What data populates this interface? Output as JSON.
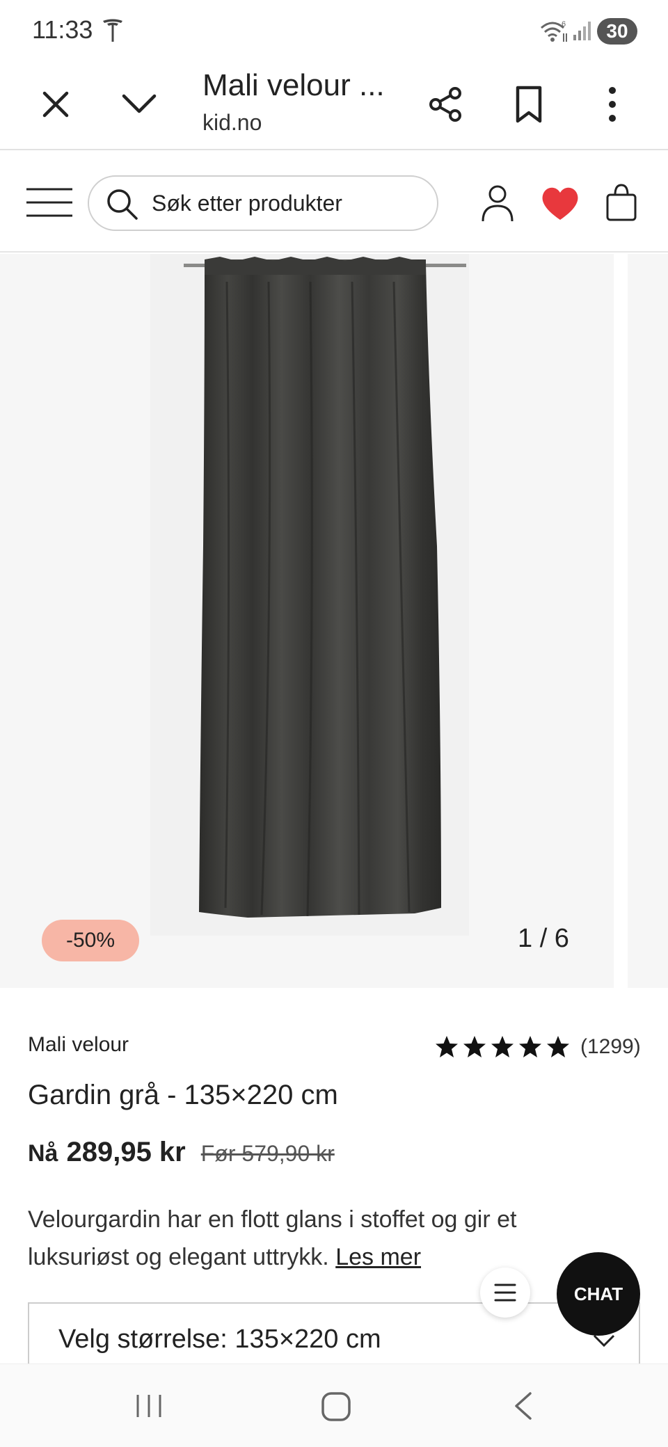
{
  "status_bar": {
    "time": "11:33",
    "battery": "30"
  },
  "browser": {
    "title": "Mali velour ...",
    "domain": "kid.no"
  },
  "header": {
    "search_placeholder": "Søk etter produkter"
  },
  "gallery": {
    "discount_badge": "-50%",
    "slide_counter": "1 / 6"
  },
  "product": {
    "brand": "Mali velour",
    "rating_stars": 5,
    "rating_count": "(1299)",
    "title": "Gardin grå - 135×220 cm",
    "price_now_label": "Nå",
    "price_now": "289,95 kr",
    "price_before": "Før 579,90 kr",
    "description": "Velourgardin har en flott glans i stoffet og gir et luksuriøst og elegant uttrykk.",
    "read_more": "Les mer"
  },
  "size_selector": {
    "label": "Velg størrelse: 135×220 cm"
  },
  "floating": {
    "chat_label": "CHAT"
  },
  "colors": {
    "heart": "#e8383d",
    "discount_badge": "#f7b6a6",
    "chat_button": "#111111",
    "gallery_bg": "#f6f6f6"
  }
}
